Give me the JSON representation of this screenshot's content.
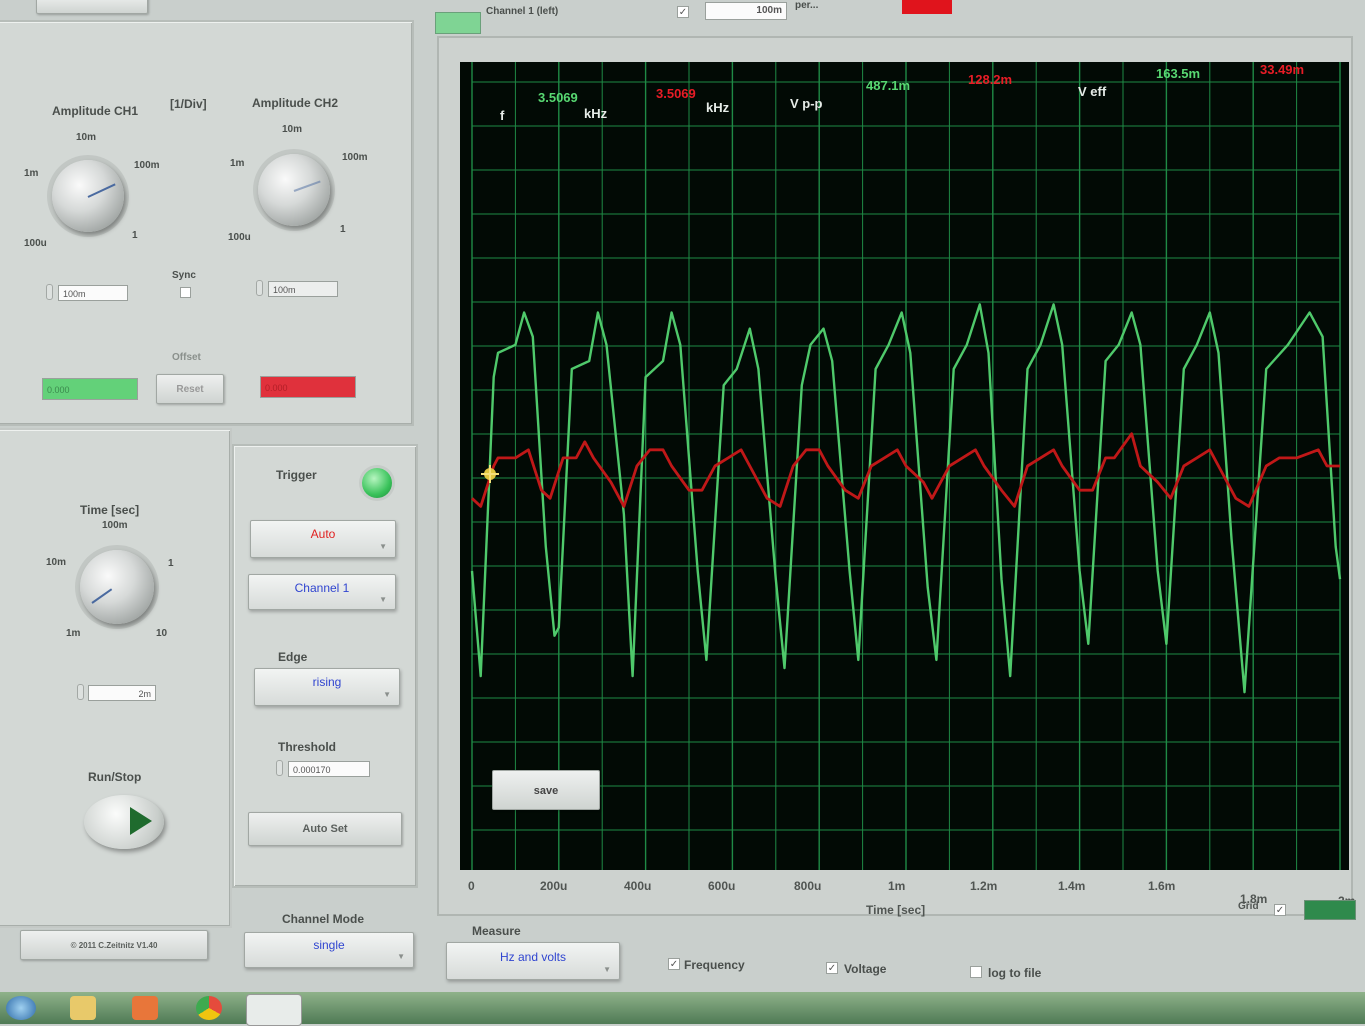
{
  "colors": {
    "ch1": "#4fc96b",
    "ch2": "#c01818",
    "grid": "#1f8a45",
    "plot_bg": "#020a05",
    "panel": "#d3d8d5"
  },
  "header": {
    "channel_indicator": "Channel 1 (left)",
    "channel_checkbox": "✓",
    "value_field": "100m",
    "per_label": "per..."
  },
  "amplitude": {
    "ch1_title": "Amplitude CH1",
    "unit_label": "[1/Div]",
    "ch2_title": "Amplitude CH2",
    "ch1_ticks": [
      "10m",
      "1m",
      "100m",
      "100u",
      "1"
    ],
    "ch2_ticks": [
      "10m",
      "1m",
      "100m",
      "100u",
      "1"
    ],
    "ch1_value": "100m",
    "ch2_value": "100m",
    "sync_label": "Sync",
    "offset_label": "Offset",
    "ch1_offset": "0.000",
    "ch2_offset": "0.000",
    "reset_label": "Reset"
  },
  "time": {
    "title": "Time [sec]",
    "ticks": [
      "100m",
      "10m",
      "1",
      "1m",
      "10"
    ],
    "value": "2m"
  },
  "run_stop": {
    "label": "Run/Stop"
  },
  "trigger": {
    "title": "Trigger",
    "mode": "Auto",
    "source": "Channel 1",
    "edge_label": "Edge",
    "edge": "rising",
    "threshold_label": "Threshold",
    "threshold": "0.000170",
    "autoset_label": "Auto Set"
  },
  "channel_mode": {
    "label": "Channel Mode",
    "value": "single"
  },
  "footer": {
    "copyright": "© 2011  C.Zeitnitz V1.40"
  },
  "measurements": {
    "f_label": "f",
    "ch1_freq": "3.5069",
    "ch1_freq_unit": "kHz",
    "ch2_freq": "3.5069",
    "ch2_freq_unit": "kHz",
    "vpp_label": "V p-p",
    "ch1_vpp": "487.1m",
    "ch2_vpp": "128.2m",
    "veff_label": "V eff",
    "ch1_veff": "163.5m",
    "ch2_veff": "33.49m"
  },
  "plot": {
    "save_label": "save",
    "xlabel": "Time [sec]",
    "grid_label": "Grid",
    "grid_checkbox": "✓"
  },
  "measure": {
    "label": "Measure",
    "mode": "Hz and volts",
    "options": [
      {
        "label": "Frequency",
        "checked": true
      },
      {
        "label": "Voltage",
        "checked": true
      },
      {
        "label": "log to file",
        "checked": false
      }
    ]
  },
  "chart_data": {
    "type": "line",
    "xlabel": "Time [sec]",
    "ylabel": "",
    "x_ticks": [
      "0",
      "200u",
      "400u",
      "600u",
      "800u",
      "1m",
      "1.2m",
      "1.4m",
      "1.6m",
      "1.8m",
      "2m"
    ],
    "xlim": [
      0,
      0.002
    ],
    "ylim": [
      -5,
      5
    ],
    "grid": true,
    "series": [
      {
        "name": "Channel 1",
        "color": "#4fc96b",
        "period": 0.000285,
        "points": [
          [
            0.0,
            -1.3
          ],
          [
            2e-05,
            -2.6
          ],
          [
            5e-05,
            1.1
          ],
          [
            6e-05,
            1.4
          ],
          [
            0.0001,
            1.5
          ],
          [
            0.00012,
            1.9
          ],
          [
            0.00014,
            1.6
          ],
          [
            0.00017,
            -1.0
          ],
          [
            0.00019,
            -2.1
          ],
          [
            0.0002,
            -2.0
          ],
          [
            0.00023,
            1.2
          ],
          [
            0.00027,
            1.3
          ],
          [
            0.00029,
            1.9
          ],
          [
            0.00031,
            1.5
          ],
          [
            0.00035,
            -0.6
          ],
          [
            0.00037,
            -2.6
          ],
          [
            0.0004,
            1.1
          ],
          [
            0.00044,
            1.3
          ],
          [
            0.00046,
            1.9
          ],
          [
            0.00048,
            1.5
          ],
          [
            0.00052,
            -1.3
          ],
          [
            0.00054,
            -2.4
          ],
          [
            0.00058,
            1.0
          ],
          [
            0.00061,
            1.2
          ],
          [
            0.00064,
            1.7
          ],
          [
            0.00066,
            1.2
          ],
          [
            0.0007,
            -1.4
          ],
          [
            0.00072,
            -2.5
          ],
          [
            0.00076,
            1.0
          ],
          [
            0.00078,
            1.5
          ],
          [
            0.00081,
            1.7
          ],
          [
            0.00083,
            1.3
          ],
          [
            0.00087,
            -1.3
          ],
          [
            0.00089,
            -2.4
          ],
          [
            0.00093,
            1.2
          ],
          [
            0.00096,
            1.5
          ],
          [
            0.00099,
            1.9
          ],
          [
            0.00101,
            1.4
          ],
          [
            0.00105,
            -1.5
          ],
          [
            0.00107,
            -2.4
          ],
          [
            0.00111,
            1.2
          ],
          [
            0.00114,
            1.5
          ],
          [
            0.00117,
            2.0
          ],
          [
            0.00119,
            1.4
          ],
          [
            0.00122,
            -1.4
          ],
          [
            0.00124,
            -2.6
          ],
          [
            0.00128,
            1.2
          ],
          [
            0.00131,
            1.5
          ],
          [
            0.00134,
            2.0
          ],
          [
            0.00136,
            1.5
          ],
          [
            0.0014,
            -1.3
          ],
          [
            0.00142,
            -2.2
          ],
          [
            0.00146,
            1.3
          ],
          [
            0.00149,
            1.5
          ],
          [
            0.00152,
            1.9
          ],
          [
            0.00154,
            1.5
          ],
          [
            0.00158,
            -1.3
          ],
          [
            0.0016,
            -2.2
          ],
          [
            0.00164,
            1.2
          ],
          [
            0.00167,
            1.5
          ],
          [
            0.0017,
            1.9
          ],
          [
            0.00172,
            1.4
          ],
          [
            0.00175,
            -0.9
          ],
          [
            0.00178,
            -2.8
          ],
          [
            0.00183,
            1.2
          ],
          [
            0.00188,
            1.5
          ],
          [
            0.00193,
            1.9
          ],
          [
            0.00196,
            1.6
          ],
          [
            0.00199,
            -1.0
          ],
          [
            0.002,
            -1.4
          ]
        ]
      },
      {
        "name": "Channel 2",
        "color": "#c01818",
        "period": 0.000285,
        "points": [
          [
            0.0,
            -0.4
          ],
          [
            2e-05,
            -0.5
          ],
          [
            5e-05,
            0.0
          ],
          [
            6e-05,
            0.1
          ],
          [
            0.0001,
            0.1
          ],
          [
            0.00013,
            0.2
          ],
          [
            0.00016,
            -0.3
          ],
          [
            0.00018,
            -0.4
          ],
          [
            0.00021,
            0.1
          ],
          [
            0.00024,
            0.1
          ],
          [
            0.00026,
            0.3
          ],
          [
            0.00028,
            0.1
          ],
          [
            0.00032,
            -0.2
          ],
          [
            0.00035,
            -0.5
          ],
          [
            0.00038,
            0.0
          ],
          [
            0.00041,
            0.2
          ],
          [
            0.00044,
            0.2
          ],
          [
            0.00046,
            0.0
          ],
          [
            0.0005,
            -0.3
          ],
          [
            0.00053,
            -0.3
          ],
          [
            0.00056,
            0.0
          ],
          [
            0.00059,
            0.1
          ],
          [
            0.00062,
            0.2
          ],
          [
            0.00064,
            0.0
          ],
          [
            0.00068,
            -0.4
          ],
          [
            0.00071,
            -0.5
          ],
          [
            0.00074,
            0.0
          ],
          [
            0.00077,
            0.2
          ],
          [
            0.0008,
            0.2
          ],
          [
            0.00082,
            0.0
          ],
          [
            0.00086,
            -0.3
          ],
          [
            0.00089,
            -0.4
          ],
          [
            0.00092,
            0.0
          ],
          [
            0.00095,
            0.1
          ],
          [
            0.00098,
            0.2
          ],
          [
            0.001,
            0.0
          ],
          [
            0.00104,
            -0.2
          ],
          [
            0.00106,
            -0.4
          ],
          [
            0.0011,
            0.0
          ],
          [
            0.00113,
            0.1
          ],
          [
            0.00116,
            0.2
          ],
          [
            0.00118,
            0.0
          ],
          [
            0.00122,
            -0.3
          ],
          [
            0.00125,
            -0.5
          ],
          [
            0.00128,
            0.0
          ],
          [
            0.00131,
            0.1
          ],
          [
            0.00134,
            0.2
          ],
          [
            0.00136,
            0.0
          ],
          [
            0.0014,
            -0.3
          ],
          [
            0.00143,
            -0.3
          ],
          [
            0.00146,
            0.1
          ],
          [
            0.00148,
            0.1
          ],
          [
            0.00152,
            0.4
          ],
          [
            0.00154,
            0.0
          ],
          [
            0.00158,
            -0.2
          ],
          [
            0.00161,
            -0.4
          ],
          [
            0.00164,
            0.0
          ],
          [
            0.00167,
            0.1
          ],
          [
            0.0017,
            0.2
          ],
          [
            0.00172,
            0.0
          ],
          [
            0.00176,
            -0.4
          ],
          [
            0.00179,
            -0.5
          ],
          [
            0.00183,
            0.0
          ],
          [
            0.00186,
            0.1
          ],
          [
            0.0019,
            0.1
          ],
          [
            0.00195,
            0.2
          ],
          [
            0.00197,
            0.0
          ],
          [
            0.002,
            0.0
          ]
        ]
      }
    ]
  }
}
